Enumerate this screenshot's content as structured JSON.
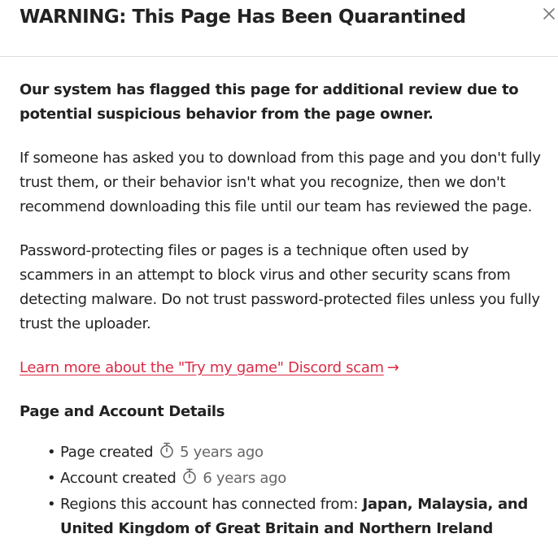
{
  "dialog": {
    "title": "WARNING: This Page Has Been Quarantined",
    "close_icon": "close-icon"
  },
  "content": {
    "lead": "Our system has flagged this page for additional review due to potential suspicious behavior from the page owner.",
    "paragraph_1": "If someone has asked you to download from this page and you don't fully trust them, or their behavior isn't what you recognize, then we don't recommend downloading this file until our team has reviewed the page.",
    "paragraph_2": "Password-protecting files or pages is a technique often used by scammers in an attempt to block virus and other security scans from detecting malware. Do not trust password-protected files unless you fully trust the uploader.",
    "learn_more_link": "Learn more about the \"Try my game\" Discord scam",
    "learn_more_arrow": "→",
    "accent_color": "#da2c46"
  },
  "details": {
    "heading": "Page and Account Details",
    "page_created_label": "Page created",
    "page_created_value": "5 years ago",
    "account_created_label": "Account created",
    "account_created_value": "6 years ago",
    "regions_label": "Regions this account has connected from:",
    "regions_value": "Japan, Malaysia, and United Kingdom of Great Britain and Northern Ireland",
    "timer_icon": "stopwatch-icon"
  }
}
